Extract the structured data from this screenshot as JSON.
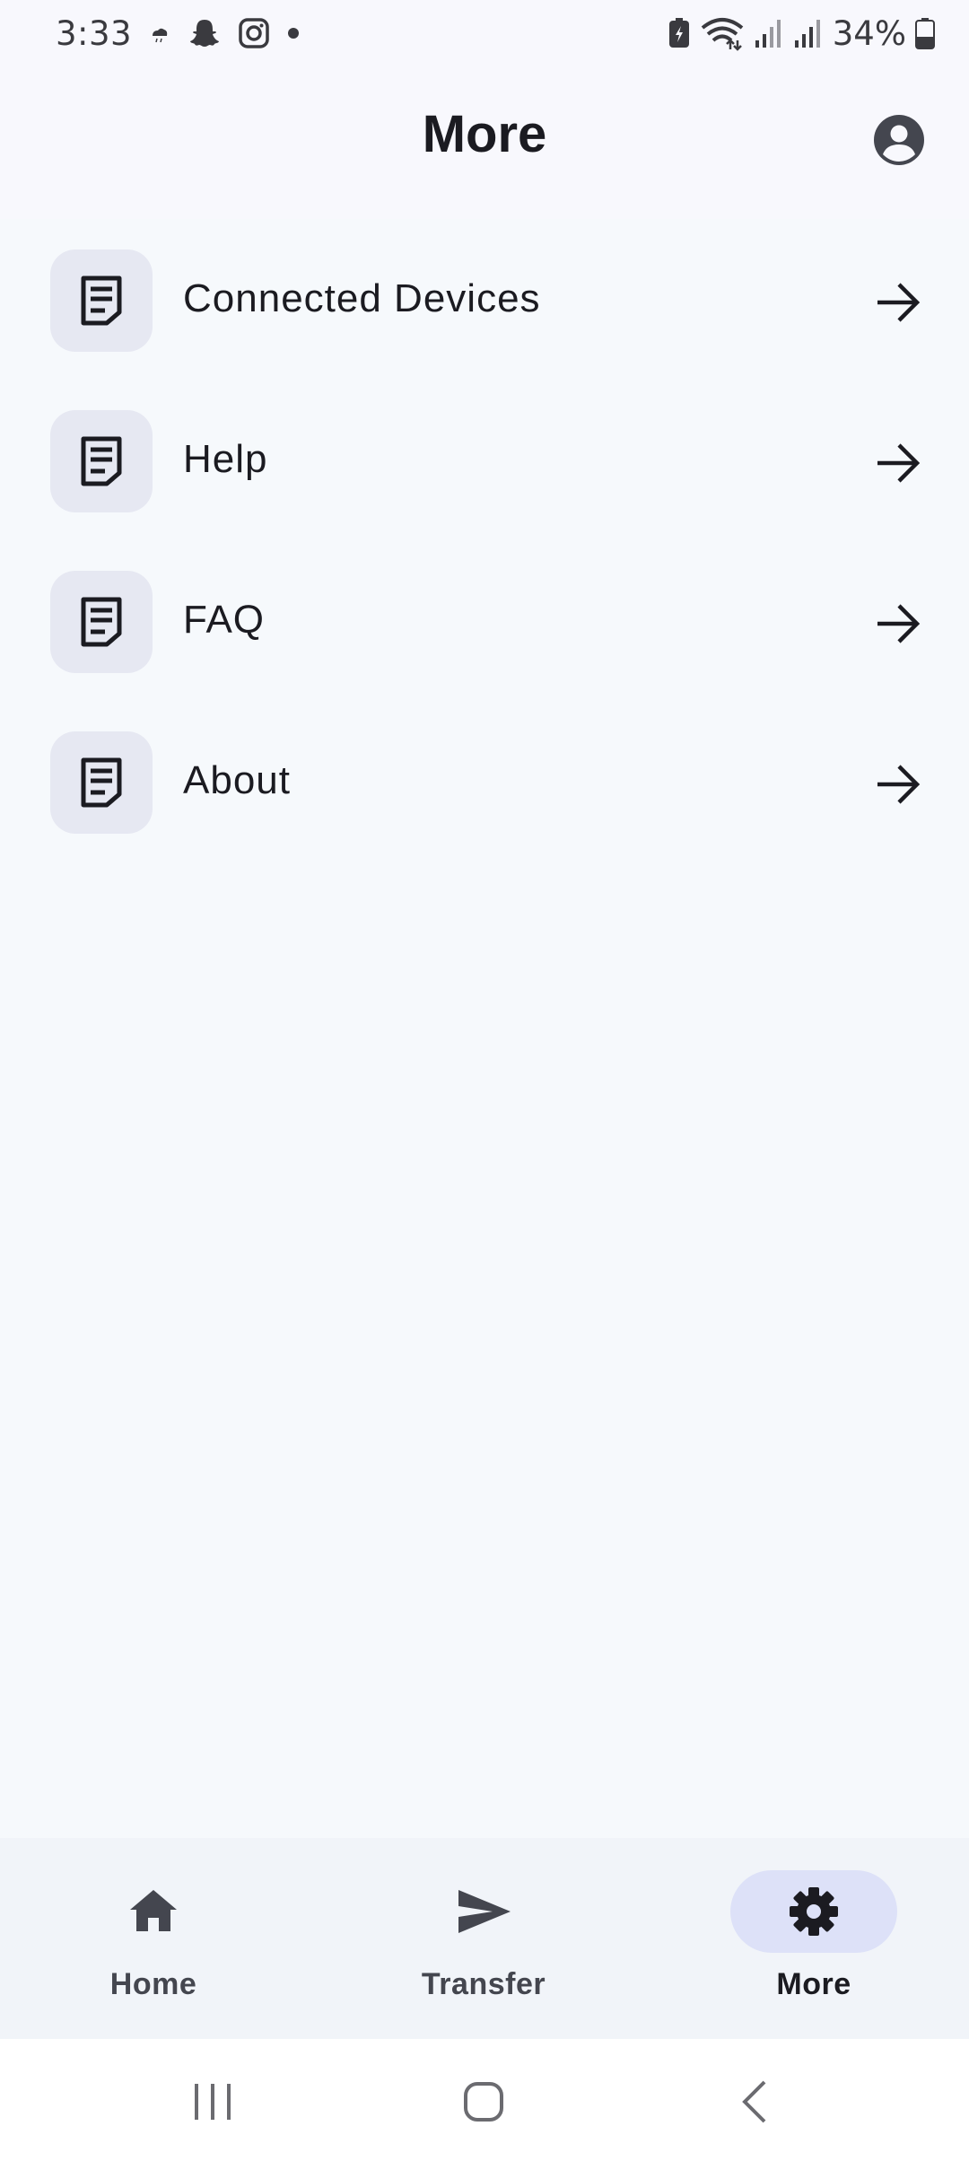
{
  "status_bar": {
    "time": "3:33",
    "battery_percent": "34%",
    "notification_icons": [
      "weather-icon",
      "snapchat-icon",
      "instagram-icon",
      "dot-icon"
    ],
    "system_icons": [
      "battery-saver-icon",
      "wifi-icon",
      "signal-icon",
      "signal-icon",
      "battery-icon"
    ]
  },
  "header": {
    "title": "More",
    "profile_icon": "account-circle-icon"
  },
  "menu": {
    "items": [
      {
        "label": "Connected Devices",
        "icon": "document-icon",
        "action_icon": "arrow-right-icon"
      },
      {
        "label": "Help",
        "icon": "document-icon",
        "action_icon": "arrow-right-icon"
      },
      {
        "label": "FAQ",
        "icon": "document-icon",
        "action_icon": "arrow-right-icon"
      },
      {
        "label": "About",
        "icon": "document-icon",
        "action_icon": "arrow-right-icon"
      }
    ]
  },
  "bottom_nav": {
    "items": [
      {
        "label": "Home",
        "icon": "home-icon",
        "active": false
      },
      {
        "label": "Transfer",
        "icon": "send-icon",
        "active": false
      },
      {
        "label": "More",
        "icon": "gear-icon",
        "active": true
      }
    ]
  },
  "system_nav": {
    "buttons": [
      "recent-apps-icon",
      "home-circle-icon",
      "back-icon"
    ]
  },
  "colors": {
    "background": "#f6f9fc",
    "header_background": "#f8f8fd",
    "icon_tile": "#e6e8f2",
    "active_pill": "#dde1f8",
    "text_primary": "#1b1b21",
    "text_secondary": "#44464f"
  }
}
